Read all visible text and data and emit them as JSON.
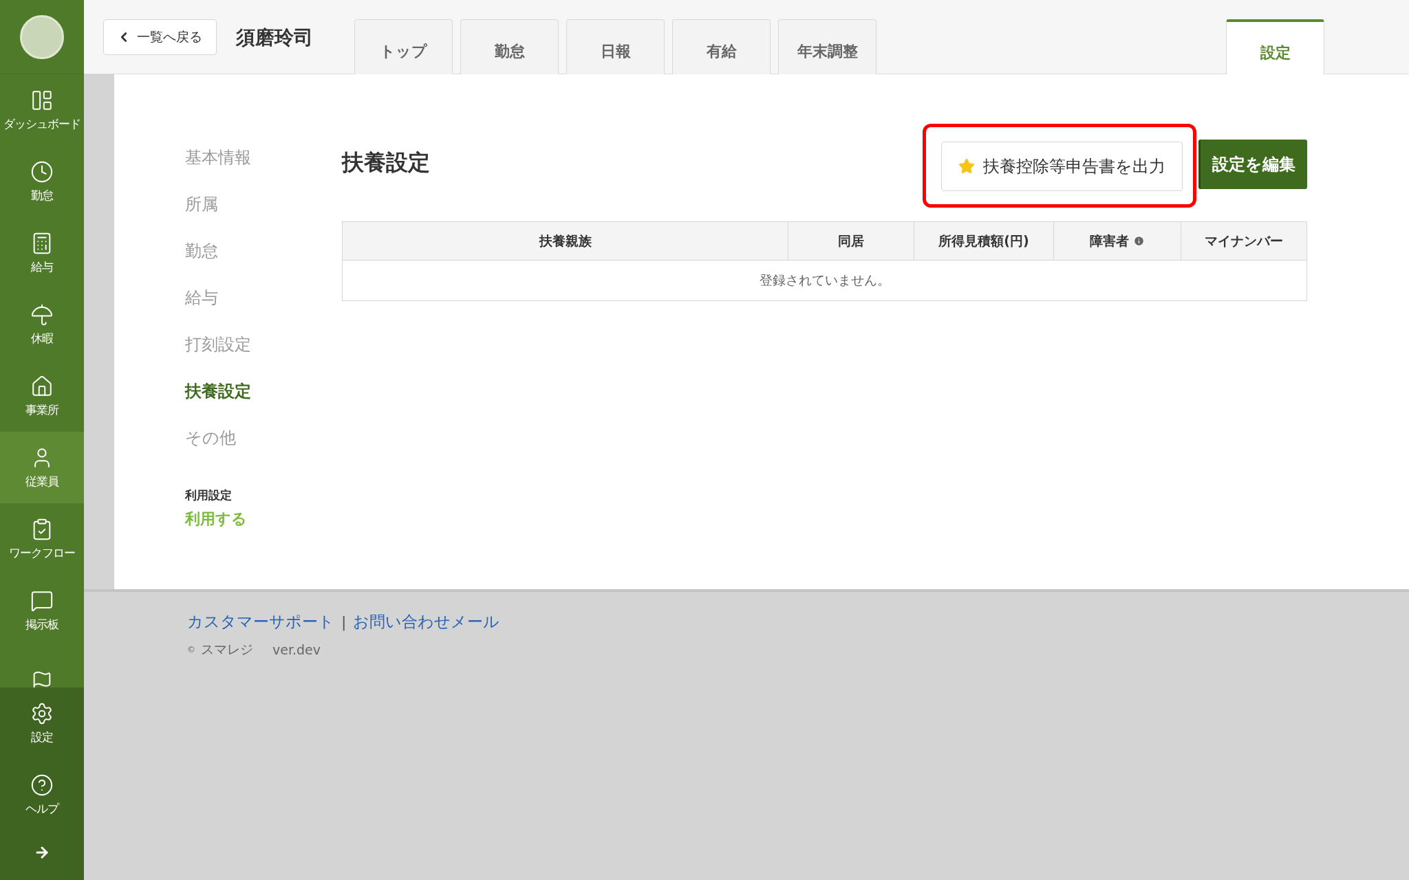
{
  "sidebar": {
    "items": [
      {
        "label": "ダッシュボード",
        "selected": false
      },
      {
        "label": "勤怠",
        "selected": false
      },
      {
        "label": "給与",
        "selected": false
      },
      {
        "label": "休暇",
        "selected": false
      },
      {
        "label": "事業所",
        "selected": false
      },
      {
        "label": "従業員",
        "selected": true
      },
      {
        "label": "ワークフロー",
        "selected": false
      },
      {
        "label": "掲示板",
        "selected": false
      },
      {
        "selected": false
      }
    ],
    "bottom_items": [
      {
        "label": "設定"
      },
      {
        "label": "ヘルプ"
      }
    ]
  },
  "header": {
    "back_button": "一覧へ戻る",
    "employee_name": "須磨玲司",
    "tabs": [
      {
        "label": "トップ",
        "selected": false
      },
      {
        "label": "勤怠",
        "selected": false
      },
      {
        "label": "日報",
        "selected": false
      },
      {
        "label": "有給",
        "selected": false
      },
      {
        "label": "年末調整",
        "selected": false
      }
    ],
    "right_tabs": [
      {
        "label": "設定",
        "selected": true
      }
    ]
  },
  "subnav": {
    "items": [
      {
        "label": "基本情報",
        "selected": false
      },
      {
        "label": "所属",
        "selected": false
      },
      {
        "label": "勤怠",
        "selected": false
      },
      {
        "label": "給与",
        "selected": false
      },
      {
        "label": "打刻設定",
        "selected": false
      },
      {
        "label": "扶養設定",
        "selected": true
      },
      {
        "label": "その他",
        "selected": false
      }
    ],
    "usage_label": "利用設定",
    "usage_value": "利用する"
  },
  "section": {
    "title": "扶養設定",
    "export_button": {
      "label": "扶養控除等申告書を出力",
      "highlighted": true
    },
    "edit_button": "設定を編集",
    "table": {
      "columns": [
        {
          "label": "扶養親族",
          "info": false
        },
        {
          "label": "同居",
          "info": false
        },
        {
          "label": "所得見積額(円)",
          "info": false
        },
        {
          "label": "障害者",
          "info": true
        },
        {
          "label": "マイナンバー",
          "info": false
        }
      ],
      "empty_message": "登録されていません。"
    }
  },
  "footer": {
    "links": [
      "カスタマーサポート",
      "お問い合わせメール"
    ],
    "separator": "|",
    "copyright_mark": "©",
    "company": "スマレジ",
    "version": "ver.dev"
  }
}
